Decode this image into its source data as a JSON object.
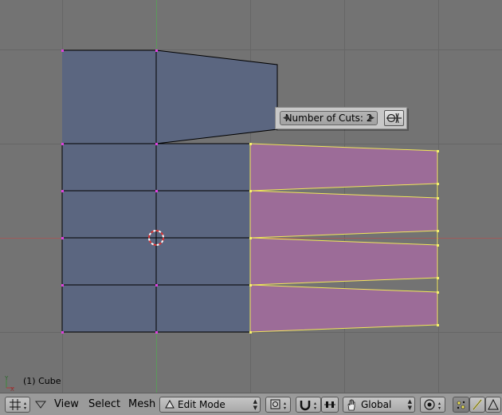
{
  "popup": {
    "number_of_cuts": "Number of Cuts: 2"
  },
  "view_info": {
    "object_label": "(1) Cube"
  },
  "axes": {
    "y": "Y",
    "x": "X"
  },
  "header": {
    "menus": [
      "View",
      "Select",
      "Mesh"
    ],
    "mode_select": "Edit Mode",
    "orientation_select": "Global"
  },
  "colors": {
    "viewport_bg": "#737373",
    "mesh_face": "#5b6680",
    "selected_face": "#9c6c98",
    "selected_edge": "#f0e65a",
    "vertex": "#e040e0",
    "grid_line": "#666666",
    "x_axis": "#a05a5a",
    "y_axis": "#5a9a5a"
  }
}
